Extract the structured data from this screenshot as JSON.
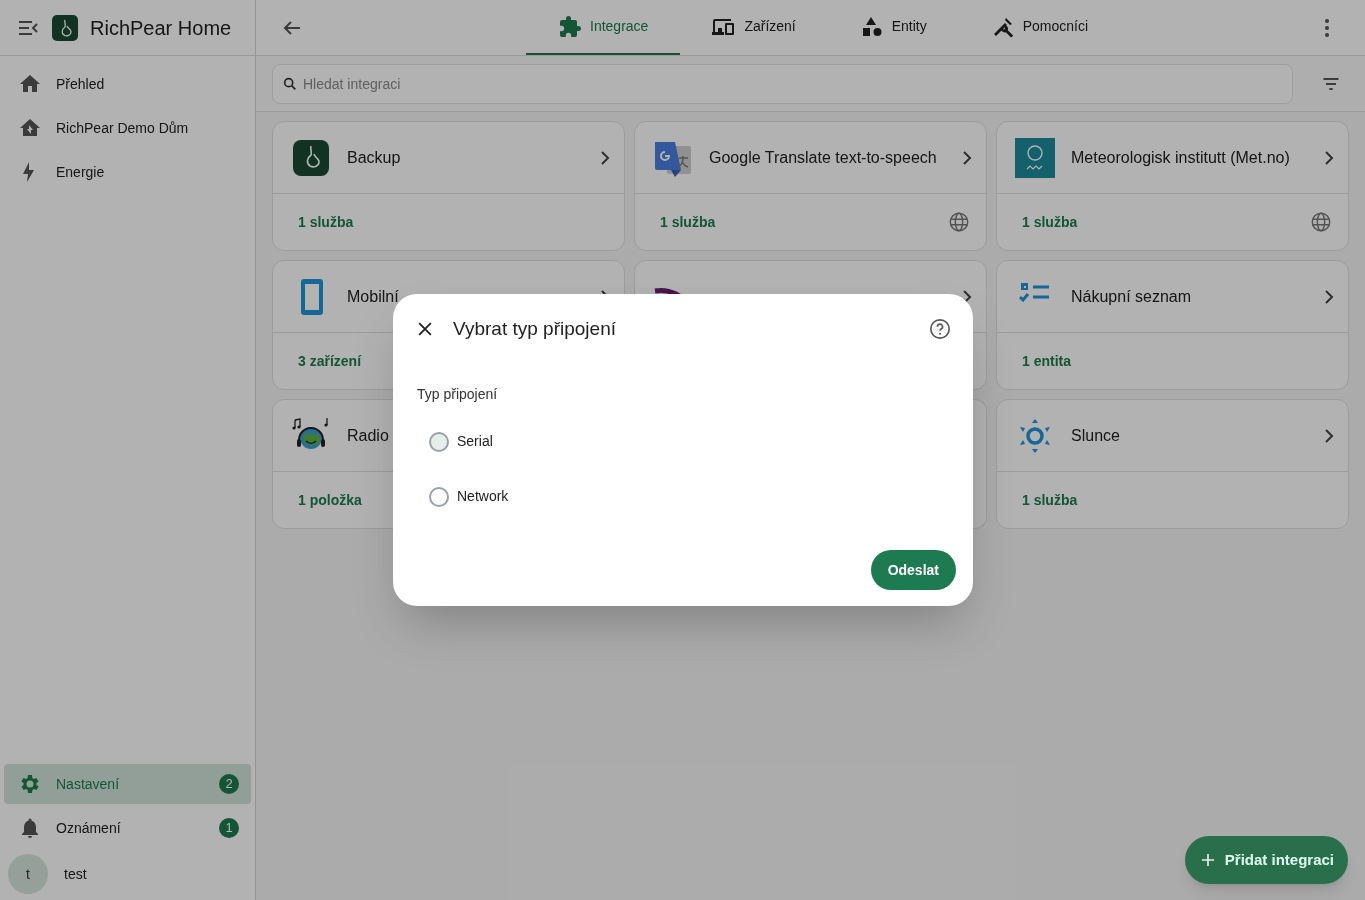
{
  "app": {
    "title": "RichPear Home"
  },
  "sidebar": {
    "items": [
      {
        "label": "Přehled",
        "selected": false
      },
      {
        "label": "RichPear Demo Dům",
        "selected": false
      },
      {
        "label": "Energie",
        "selected": false
      }
    ],
    "bottom_items": [
      {
        "label": "Nastavení",
        "selected": true,
        "badge": "2"
      },
      {
        "label": "Oznámení",
        "selected": false,
        "badge": "1"
      }
    ],
    "user": {
      "initial": "t",
      "name": "test"
    }
  },
  "tabs": [
    {
      "label": "Integrace",
      "selected": true
    },
    {
      "label": "Zařízení",
      "selected": false
    },
    {
      "label": "Entity",
      "selected": false
    },
    {
      "label": "Pomocníci",
      "selected": false
    }
  ],
  "search": {
    "placeholder": "Hledat integraci"
  },
  "integrations": [
    {
      "kind": "card",
      "title": "Backup",
      "footer": "1 služba",
      "cloud": false
    },
    {
      "kind": "card",
      "title": "Google Translate text-to-speech",
      "footer": "1 služba",
      "cloud": true
    },
    {
      "kind": "card",
      "title": "Meteorologisk institutt (Met.no)",
      "footer": "1 služba",
      "cloud": true
    },
    {
      "kind": "card",
      "title": "Mobilní",
      "footer": "3 zařízení",
      "cloud": false
    },
    {
      "kind": "covered_header"
    },
    {
      "kind": "card",
      "title": "Nákupní seznam",
      "footer": "1 entita",
      "cloud": false
    },
    {
      "kind": "card_right_covered",
      "title": "Radio",
      "footer": "1 položka",
      "cloud": false
    },
    {
      "kind": "covered"
    },
    {
      "kind": "card",
      "title": "Slunce",
      "footer": "1 služba",
      "cloud": false
    }
  ],
  "dialog": {
    "title": "Vybrat typ připojení",
    "field_label": "Typ připojení",
    "options": [
      {
        "label": "Serial",
        "selected": false,
        "focused": true
      },
      {
        "label": "Network",
        "selected": false,
        "focused": false
      }
    ],
    "submit": "Odeslat"
  },
  "fab": {
    "label": "Přidat integraci"
  }
}
